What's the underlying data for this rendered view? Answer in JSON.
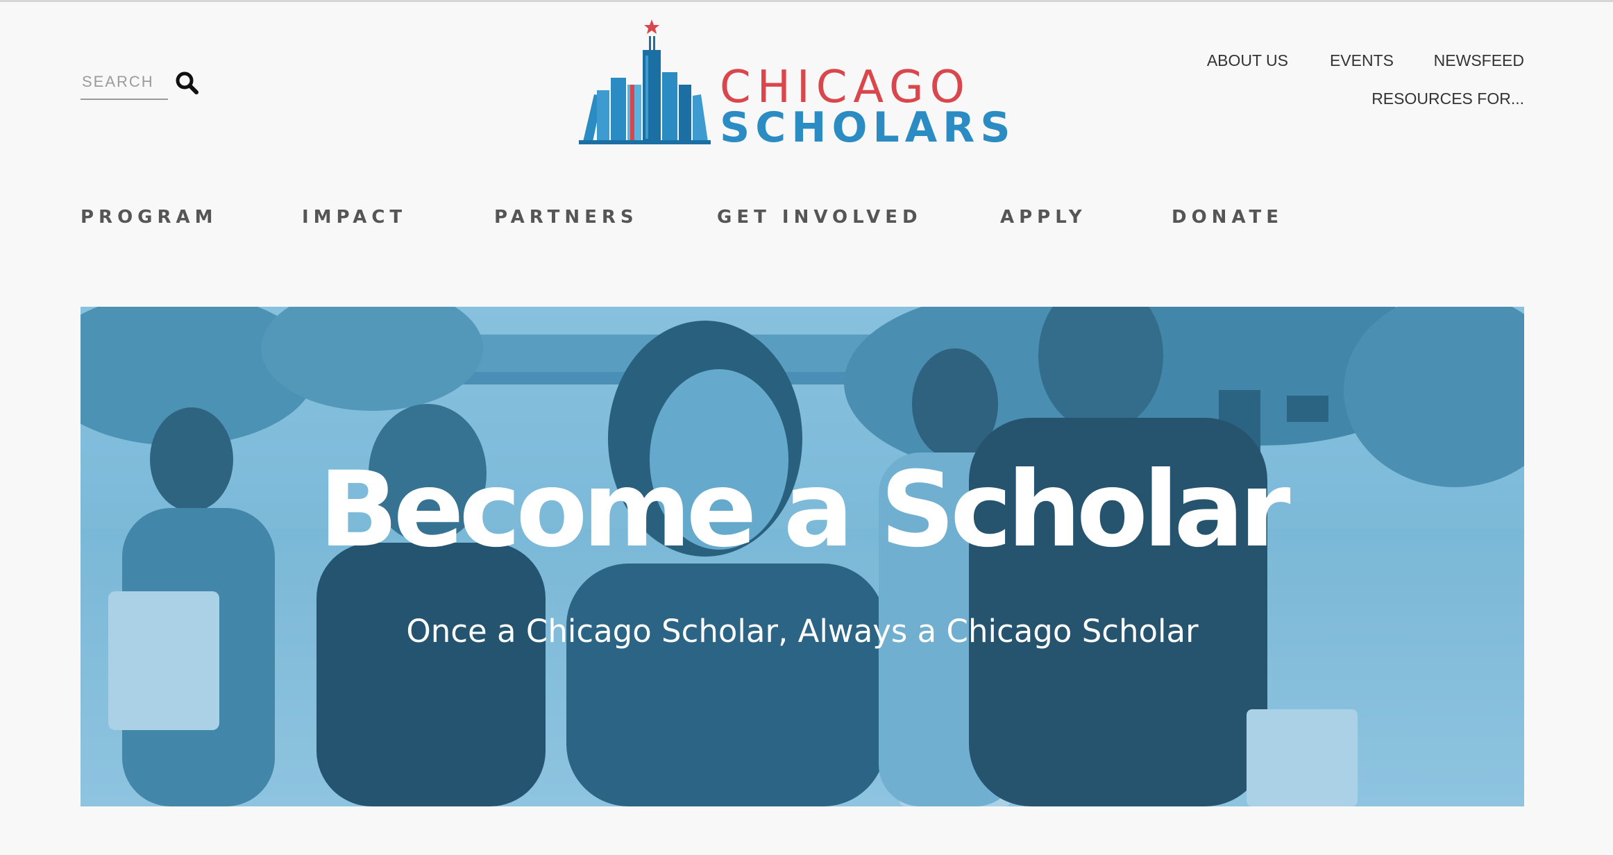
{
  "search": {
    "placeholder": "SEARCH",
    "icon": "search-icon"
  },
  "logo": {
    "line1": "CHICAGO",
    "line2": "SCHOLARS",
    "colors": {
      "red": "#d9474c",
      "blue": "#2a8cc2",
      "dark_blue": "#1b6fa3"
    }
  },
  "utility_nav": {
    "items": [
      {
        "label": "ABOUT US"
      },
      {
        "label": "EVENTS"
      },
      {
        "label": "NEWSFEED"
      },
      {
        "label": "RESOURCES FOR..."
      }
    ]
  },
  "main_nav": {
    "items": [
      {
        "label": "PROGRAM"
      },
      {
        "label": "IMPACT"
      },
      {
        "label": "PARTNERS"
      },
      {
        "label": "GET INVOLVED"
      },
      {
        "label": "APPLY"
      },
      {
        "label": "DONATE"
      }
    ]
  },
  "hero": {
    "title": "Become a Scholar",
    "subtitle": "Once a Chicago Scholar, Always a Chicago Scholar",
    "overlay_color": "#4a9cc4"
  }
}
